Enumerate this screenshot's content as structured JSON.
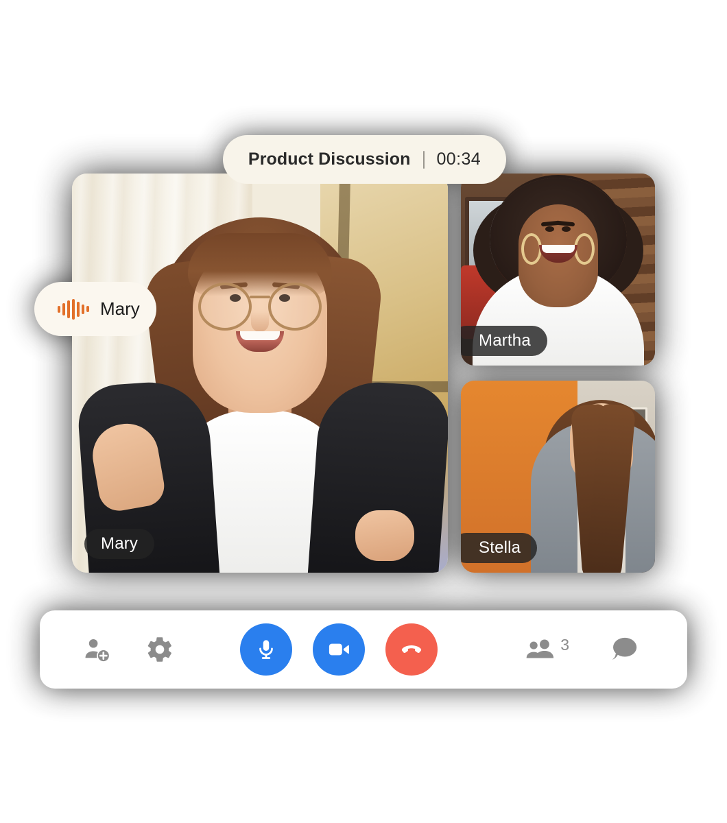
{
  "meeting": {
    "title": "Product Discussion",
    "separator": "|",
    "timer": "00:34"
  },
  "active_speaker": {
    "name": "Mary",
    "icon": "audio-waveform-icon",
    "waveform_heights": [
      10,
      18,
      26,
      30,
      22,
      14,
      9
    ],
    "accent_color": "#e2702a"
  },
  "tiles": [
    {
      "id": "main",
      "name": "Mary",
      "position": "main"
    },
    {
      "id": "top-right",
      "name": "Martha",
      "position": "top-right"
    },
    {
      "id": "bottom-right",
      "name": "Stella",
      "position": "bottom-right"
    }
  ],
  "toolbar": {
    "add_participant": {
      "label": "Add participant",
      "icon": "add-person-icon",
      "color": "#8c8c8c"
    },
    "settings": {
      "label": "Settings",
      "icon": "gear-icon",
      "color": "#8c8c8c"
    },
    "microphone": {
      "label": "Mute microphone",
      "icon": "microphone-icon",
      "color": "#2a7fee",
      "state": "on"
    },
    "camera": {
      "label": "Stop video",
      "icon": "video-camera-icon",
      "color": "#2a7fee",
      "state": "on"
    },
    "end_call": {
      "label": "End call",
      "icon": "phone-hangup-icon",
      "color": "#f4604e"
    },
    "participants": {
      "label": "Participants",
      "icon": "people-icon",
      "count": "3",
      "color": "#8c8c8c"
    },
    "chat": {
      "label": "Chat",
      "icon": "chat-bubble-icon",
      "color": "#8c8c8c"
    }
  }
}
